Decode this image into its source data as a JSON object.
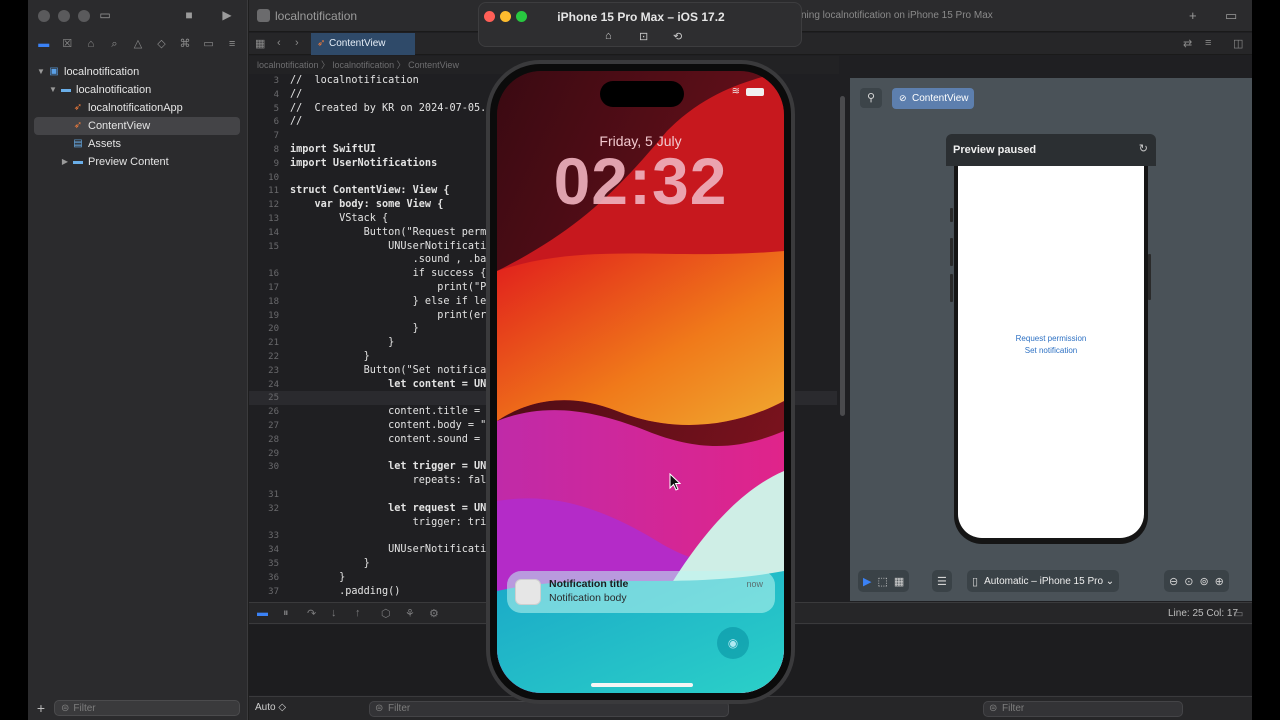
{
  "navigator": {
    "project": "localnotification",
    "group": "localnotification",
    "files": [
      "localnotificationApp",
      "ContentView",
      "Assets",
      "Preview Content"
    ],
    "selected": "ContentView",
    "filter_placeholder": "Filter"
  },
  "toolbar": {
    "title": "localnotification",
    "status": "ning localnotification on iPhone 15 Pro Max"
  },
  "tab": {
    "label": "ContentView"
  },
  "jumpbar": {
    "text": "localnotification 〉 localnotification 〉 ContentView"
  },
  "code": {
    "current_line": "25",
    "lines": [
      {
        "n": "3",
        "t": "//  localnotification"
      },
      {
        "n": "4",
        "t": "//"
      },
      {
        "n": "5",
        "t": "//  Created by KR on 2024-07-05."
      },
      {
        "n": "6",
        "t": "//"
      },
      {
        "n": "7",
        "t": ""
      },
      {
        "n": "8",
        "t": "import SwiftUI"
      },
      {
        "n": "9",
        "t": "import UserNotifications"
      },
      {
        "n": "10",
        "t": ""
      },
      {
        "n": "11",
        "t": "struct ContentView: View {"
      },
      {
        "n": "12",
        "t": "    var body: some View {"
      },
      {
        "n": "13",
        "t": "        VStack {"
      },
      {
        "n": "14",
        "t": "            Button(\"Request perm"
      },
      {
        "n": "15",
        "t": "                UNUserNotificati                                 ert,"
      },
      {
        "n": "",
        "t": "                    .sound , .bad"
      },
      {
        "n": "16",
        "t": "                    if success {"
      },
      {
        "n": "17",
        "t": "                        print(\"P"
      },
      {
        "n": "18",
        "t": "                    } else if le"
      },
      {
        "n": "19",
        "t": "                        print(err"
      },
      {
        "n": "20",
        "t": "                    }"
      },
      {
        "n": "21",
        "t": "                }"
      },
      {
        "n": "22",
        "t": "            }"
      },
      {
        "n": "23",
        "t": "            Button(\"Set notificat"
      },
      {
        "n": "24",
        "t": "                let content = UN"
      },
      {
        "n": "25",
        "t": ""
      },
      {
        "n": "26",
        "t": "                content.title = \""
      },
      {
        "n": "27",
        "t": "                content.body = \"N"
      },
      {
        "n": "28",
        "t": "                content.sound = U"
      },
      {
        "n": "29",
        "t": ""
      },
      {
        "n": "30",
        "t": "                let trigger = UNT"
      },
      {
        "n": "",
        "t": "                    repeats: fals"
      },
      {
        "n": "31",
        "t": ""
      },
      {
        "n": "32",
        "t": "                let request = UNN                                tent,"
      },
      {
        "n": "",
        "t": "                    trigger: trig"
      },
      {
        "n": "33",
        "t": ""
      },
      {
        "n": "34",
        "t": "                UNUserNotificati"
      },
      {
        "n": "35",
        "t": "            }"
      },
      {
        "n": "36",
        "t": "        }"
      },
      {
        "n": "37",
        "t": "        .padding()"
      }
    ]
  },
  "editor_status": {
    "position": "Line: 25  Col: 17"
  },
  "console": {
    "scope": "Auto ◇",
    "filter_placeholder": "Filter"
  },
  "canvas": {
    "tag": "ContentView",
    "preview_title": "Preview paused",
    "preview_buttons": [
      "Request permission",
      "Set notification"
    ],
    "device_selector": "Automatic – iPhone 15 Pro ⌄"
  },
  "simulator": {
    "title": "iPhone 15 Pro Max – iOS 17.2",
    "date": "Friday, 5 July",
    "time": "02:32",
    "notification": {
      "title": "Notification title",
      "body": "Notification body",
      "time": "now"
    }
  }
}
